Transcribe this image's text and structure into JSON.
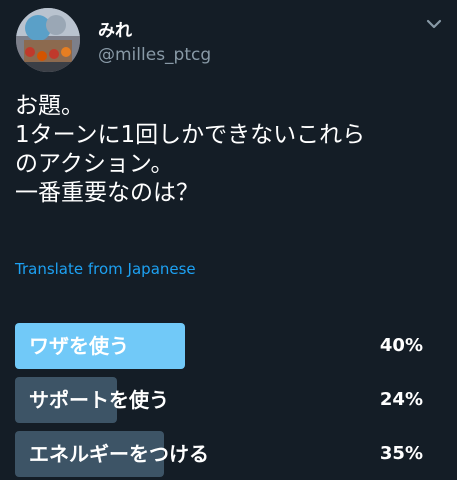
{
  "colors": {
    "background": "#141d26",
    "text": "#ffffff",
    "secondary_text": "#8899a6",
    "link": "#1da1f2",
    "poll_winner": "#71c9f8",
    "poll_other": "#3d5466"
  },
  "author": {
    "display_name": "みれ",
    "handle": "@milles_ptcg",
    "avatar_icon": "avatar-icon"
  },
  "tweet": {
    "lines": [
      "お題。",
      "1ターンに1回しかできないこれら",
      "のアクション。",
      "一番重要なのは？"
    ],
    "translate_link": "Translate from Japanese"
  },
  "poll": {
    "options": [
      {
        "label": "ワザを使う",
        "percent_text": "40%",
        "percent": 40,
        "winner": true
      },
      {
        "label": "サポートを使う",
        "percent_text": "24%",
        "percent": 24,
        "winner": false
      },
      {
        "label": "エネルギーをつける",
        "percent_text": "35%",
        "percent": 35,
        "winner": false
      }
    ]
  }
}
